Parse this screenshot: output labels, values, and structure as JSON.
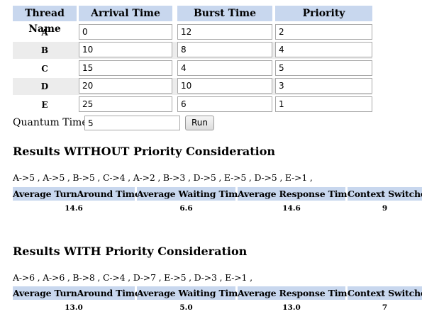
{
  "thread_table": {
    "headers": [
      "Thread Name",
      "Arrival Time",
      "Burst Time",
      "Priority"
    ],
    "rows": [
      {
        "name": "A",
        "arrival": "0",
        "burst": "12",
        "priority": "2"
      },
      {
        "name": "B",
        "arrival": "10",
        "burst": "8",
        "priority": "4"
      },
      {
        "name": "C",
        "arrival": "15",
        "burst": "4",
        "priority": "5"
      },
      {
        "name": "D",
        "arrival": "20",
        "burst": "10",
        "priority": "3"
      },
      {
        "name": "E",
        "arrival": "25",
        "burst": "6",
        "priority": "1"
      }
    ]
  },
  "quantum": {
    "label": "Quantum Time :",
    "value": "5",
    "run_label": "Run"
  },
  "results_without": {
    "title": "Results WITHOUT Priority Consideration",
    "sequence": "A->5 , A->5 , B->5 , C->4 , A->2 , B->3 , D->5 , E->5 , D->5 , E->1 ,",
    "headers": [
      "Average TurnAround Time",
      "Average Waiting Time",
      "Average Response Time",
      "Context Switches"
    ],
    "values": [
      "14.6",
      "6.6",
      "14.6",
      "9"
    ]
  },
  "results_with": {
    "title": "Results WITH Priority Consideration",
    "sequence": "A->6 , A->6 , B->8 , C->4 , D->7 , E->5 , D->3 , E->1 ,",
    "headers": [
      "Average TurnAround Time",
      "Average Waiting Time",
      "Average Response Time",
      "Context Switches"
    ],
    "values": [
      "13.0",
      "5.0",
      "13.0",
      "7"
    ]
  },
  "colors": {
    "header_bg": "#c8d7ee",
    "row_shade": "#ececec"
  }
}
